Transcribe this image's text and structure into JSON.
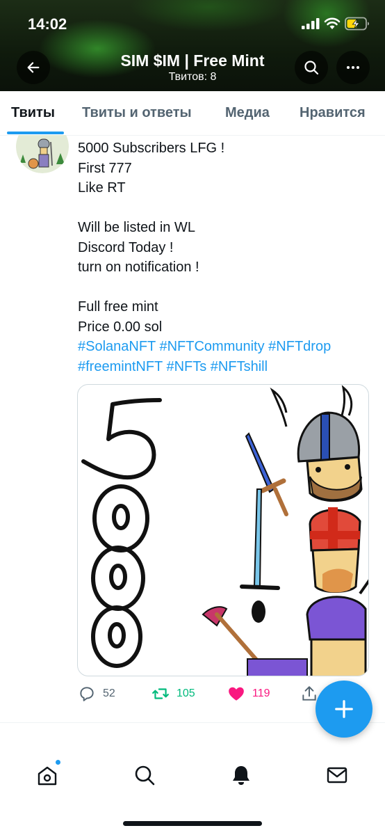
{
  "status_bar": {
    "time": "14:02"
  },
  "header": {
    "title": "SIM $IM | Free Mint",
    "subtitle": "Твитов: 8"
  },
  "tabs": [
    {
      "label": "Твиты",
      "active": true
    },
    {
      "label": "Твиты и ответы",
      "active": false
    },
    {
      "label": "Медиа",
      "active": false
    },
    {
      "label": "Нравится",
      "active": false
    }
  ],
  "tweet": {
    "lines": [
      "5000 Subscribers LFG !",
      "First 777",
      "Like RT",
      "",
      "Will be listed in WL",
      "Discord Today !",
      "turn on notification !",
      "",
      "Full free mint",
      "Price 0.00 sol"
    ],
    "hashtag_lines": [
      "#SolanaNFT #NFTCommunity #NFTdrop",
      "#freemintNFT #NFTs #NFTshill"
    ],
    "media": {
      "caption_digits": "5000"
    },
    "stats": {
      "replies": "52",
      "retweets": "105",
      "likes": "119"
    }
  },
  "colors": {
    "accent": "#1d9bf0",
    "retweet": "#00ba7c",
    "like": "#f91880",
    "muted": "#536471"
  },
  "icons": {
    "back": "arrow-left-icon",
    "search": "search-icon",
    "more": "more-icon",
    "reply": "reply-icon",
    "retweet": "retweet-icon",
    "like": "heart-icon",
    "share": "share-icon",
    "compose": "plus-icon",
    "home": "home-icon",
    "notifications": "bell-icon",
    "messages": "mail-icon"
  }
}
